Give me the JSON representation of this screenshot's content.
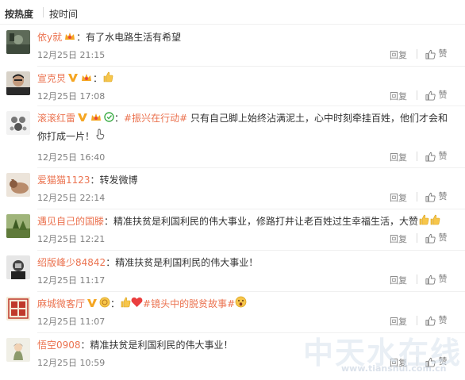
{
  "sort": {
    "hot_label": "按热度",
    "time_label": "按时间"
  },
  "actions": {
    "reply_label": "回复",
    "like_label": "赞"
  },
  "colors": {
    "name": "#eb7350",
    "meta": "#808080",
    "vip_badge": "#f5a623",
    "heart": "#ea3e3e"
  },
  "comments": [
    {
      "user": "依y就",
      "badges": [
        "vip-crown-icon"
      ],
      "text": "：有了水电路生活有希望",
      "time": "12月25日 21:15"
    },
    {
      "user": "宣克炅",
      "badges": [
        "verified-v-icon",
        "vip-crown-icon"
      ],
      "text": "：",
      "emoji_after": "thumbs-up-emoji",
      "time": "12月25日 17:08"
    },
    {
      "user": "滚滚红雷",
      "badges": [
        "verified-v-icon",
        "vip-crown-icon",
        "green-shield-icon"
      ],
      "prefix": "：",
      "topic": "#振兴在行动#",
      "text": " 只有自己脚上始终沾满泥土，心中时刻牵挂百姓，他们才会和",
      "text_line2": "你打成一片！",
      "emoji_after_line2": "finger-emoji",
      "time": "12月25日 16:40"
    },
    {
      "user": "爱猫猫1123",
      "text": "：转发微博",
      "time": "12月25日 22:14"
    },
    {
      "user": "遇见自己的国滕",
      "text": "：精准扶贫是利国利民的伟大事业，修路打井让老百姓过生幸福生活，大赞",
      "emoji_after": "thumbs-up-emoji x2",
      "time": "12月25日 12:21"
    },
    {
      "user": "绍版峰少84842",
      "text": "：精准扶贫是利国利民的伟大事业！",
      "time": "12月25日 11:17"
    },
    {
      "user": "麻城微客厅",
      "badges": [
        "verified-v-icon",
        "rank-medal-icon"
      ],
      "prefix": "：",
      "emoji_before": "thumbs-up-emoji heart-emoji",
      "topic": "#镜头中的脱贫故事#",
      "emoji_after": "surprised-emoji",
      "text": "",
      "time": "12月25日 11:07"
    },
    {
      "user": "悟空0908",
      "text": "：精准扶贫是利国利民的伟大事业！",
      "time": "12月25日 10:59"
    }
  ],
  "watermark": {
    "title": "中天水在线",
    "url": "www.tianshui.com.cn"
  }
}
